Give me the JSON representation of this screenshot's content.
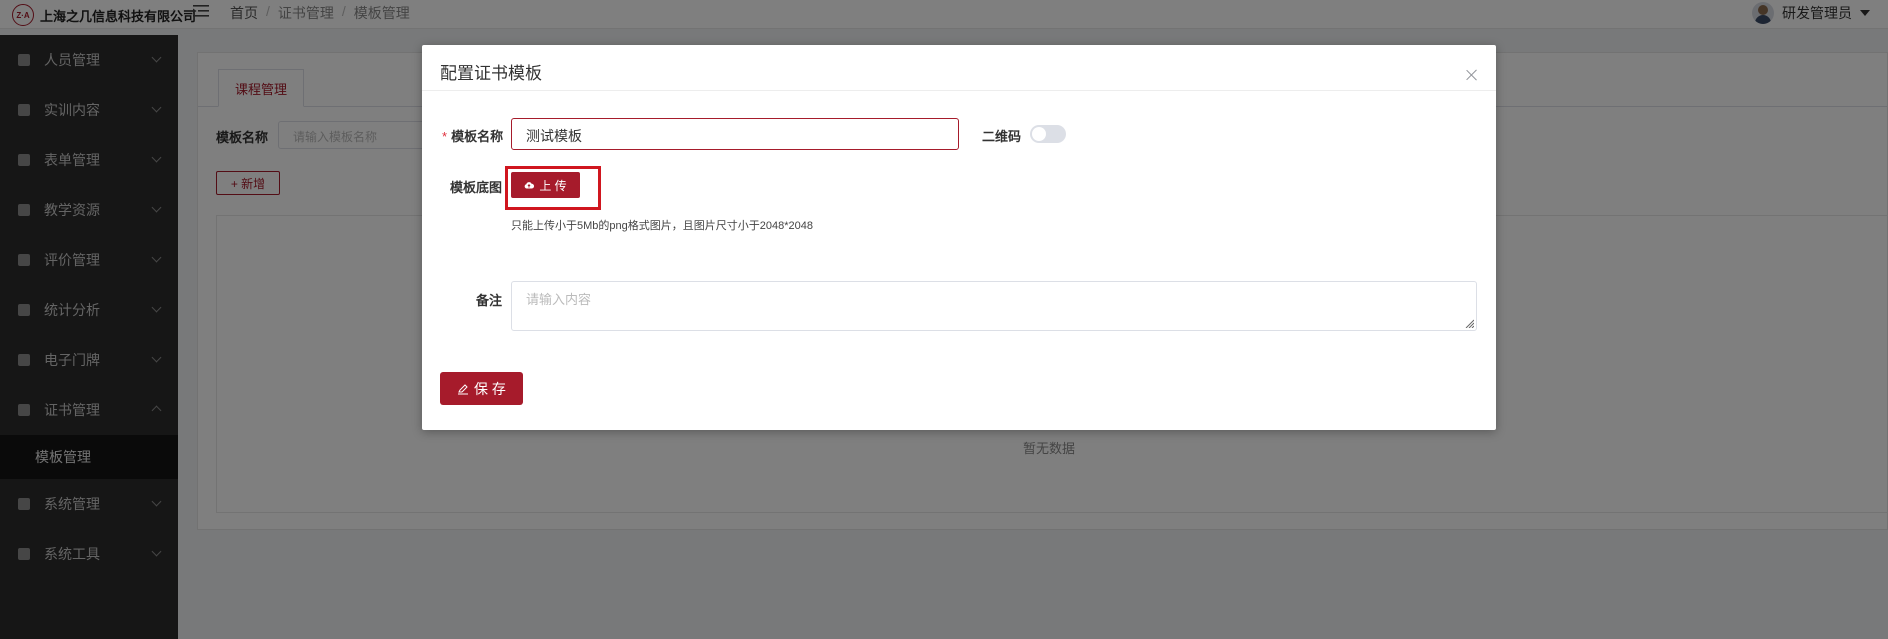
{
  "header": {
    "company_name": "上海之几信息科技有限公司",
    "logo_mark": "Z·A",
    "breadcrumb": [
      "首页",
      "证书管理",
      "模板管理"
    ],
    "user_name": "研发管理员"
  },
  "sidebar": {
    "items": [
      {
        "label": "人员管理",
        "icon": "user-icon"
      },
      {
        "label": "实训内容",
        "icon": "document-icon"
      },
      {
        "label": "表单管理",
        "icon": "form-icon"
      },
      {
        "label": "教学资源",
        "icon": "book-icon"
      },
      {
        "label": "评价管理",
        "icon": "rating-icon"
      },
      {
        "label": "统计分析",
        "icon": "bar-chart-icon"
      },
      {
        "label": "电子门牌",
        "icon": "monitor-icon"
      },
      {
        "label": "证书管理",
        "icon": "certificate-icon",
        "expanded": true
      },
      {
        "label": "系统管理",
        "icon": "gear-icon"
      },
      {
        "label": "系统工具",
        "icon": "toolbox-icon"
      }
    ],
    "active_sub_item": "模板管理"
  },
  "main": {
    "tab_label": "课程管理",
    "filter_label": "模板名称",
    "filter_placeholder": "请输入模板名称",
    "add_button_label": "+ 新增",
    "empty_text": "暂无数据"
  },
  "modal": {
    "title": "配置证书模板",
    "name_label": "模板名称",
    "name_value": "测试模板",
    "required_mark": "*",
    "qrcode_label": "二维码",
    "qrcode_enabled": false,
    "background_label": "模板底图",
    "upload_button_label": "上 传",
    "upload_tip": "只能上传小于5Mb的png格式图片，且图片尺寸小于2048*2048",
    "remark_label": "备注",
    "remark_placeholder": "请输入内容",
    "save_button_label": "保 存"
  },
  "colors": {
    "accent": "#a61b2b",
    "sidebar_bg": "#2c2c2c",
    "sidebar_active_bg": "#141414",
    "highlight": "#d0161f"
  }
}
